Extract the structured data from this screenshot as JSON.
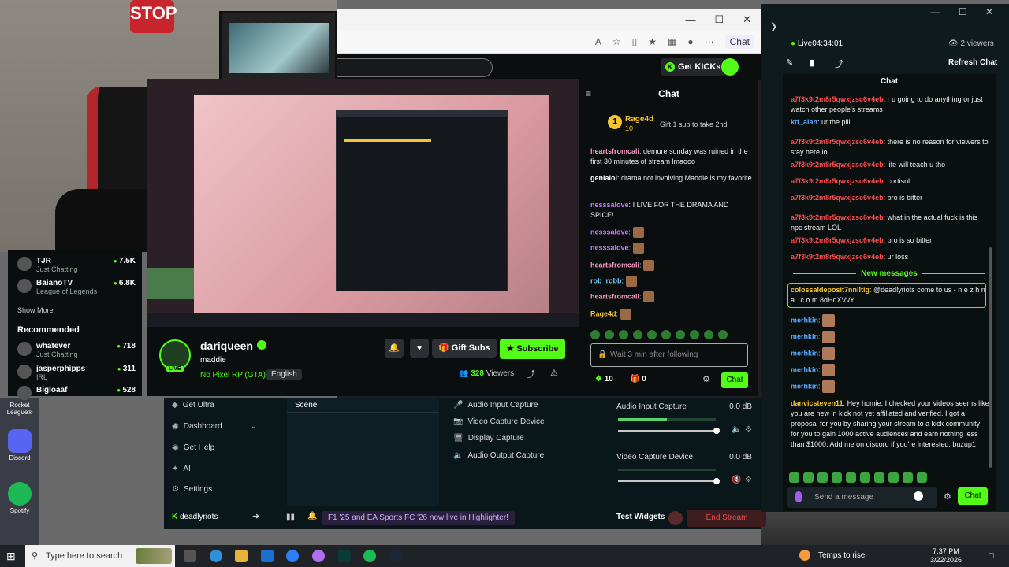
{
  "browser": {
    "chat_label": "Chat",
    "get_kicks": "Get KICKs"
  },
  "webcam": {
    "stop_sign": "STOP"
  },
  "sidebar": {
    "channels": [
      {
        "name": "TJR",
        "category": "Just Chatting",
        "viewers": "7.5K"
      },
      {
        "name": "BaianoTV",
        "category": "League of Legends",
        "viewers": "6.8K"
      }
    ],
    "show_more": "Show More",
    "recommended_title": "Recommended",
    "recommended": [
      {
        "name": "whatever",
        "category": "Just Chatting",
        "viewers": "718"
      },
      {
        "name": "jasperphipps",
        "category": "IRL",
        "viewers": "311"
      },
      {
        "name": "Bigloaaf",
        "category": "",
        "viewers": "528"
      }
    ]
  },
  "stream": {
    "streamer": "dariqueen",
    "live_tag": "LIVE",
    "title": "maddie",
    "category": "No Pixel RP (GTA)",
    "language": "English",
    "gift_subs": "Gift Subs",
    "subscribe": "Subscribe",
    "viewers_count": "328",
    "viewers_label": "Viewers"
  },
  "kick_chat": {
    "title": "Chat",
    "pinned": {
      "rank": "1",
      "user": "Rage4d",
      "amount": "10",
      "gift_text": "Gift 1 sub to take 2nd"
    },
    "messages": [
      {
        "user": "heartsfromcali",
        "text": "demure sunday was ruined in the first 30 minutes of stream lmaooo",
        "color": "#f49ac2"
      },
      {
        "user": "genialol",
        "text": "drama not involving Maddie is my favorite",
        "color": "#ffffff"
      },
      {
        "user": "nesssalove",
        "text": "I LIVE FOR THE DRAMA AND SPICE!",
        "color": "#c57cf5"
      },
      {
        "user": "nesssalove",
        "text": "",
        "color": "#c57cf5"
      },
      {
        "user": "nesssalove",
        "text": "",
        "color": "#c57cf5"
      },
      {
        "user": "heartsfromcali",
        "text": "",
        "color": "#f49ac2"
      },
      {
        "user": "rob_robb",
        "text": "",
        "color": "#7cc7f5"
      },
      {
        "user": "heartsfromcali",
        "text": "",
        "color": "#f49ac2"
      },
      {
        "user": "Rage4d",
        "text": "",
        "color": "#f4c430"
      }
    ],
    "input_placeholder": "Wait 3 min after following",
    "kicks_count": "10",
    "gift_count": "0",
    "chat_button": "Chat"
  },
  "streamlabs": {
    "nav": [
      "Get Ultra",
      "Dashboard",
      "Get Help",
      "AI",
      "Settings"
    ],
    "scene_header": "Scene",
    "sources": [
      "Audio Input Capture",
      "Video Capture Device",
      "Display Capture",
      "Audio Output Capture"
    ],
    "mixer": [
      {
        "label": "Audio Input Capture",
        "db": "0.0 dB",
        "level": 0.5
      },
      {
        "label": "Video Capture Device",
        "db": "0.0 dB",
        "level": 0
      }
    ],
    "user": "deadlyriots",
    "notification": "F1 '25 and EA Sports FC '26 now live in Highlighter!",
    "test_widgets": "Test Widgets",
    "end_stream": "End Stream"
  },
  "desktop_icons": [
    {
      "label": "Rocket League®",
      "color": "#2a5bd7"
    },
    {
      "label": "Discord",
      "color": "#5865f2"
    },
    {
      "label": "Spotify",
      "color": "#1db954"
    }
  ],
  "right_chat": {
    "live_label": "Live",
    "live_time": "04:34:01",
    "viewers": "2 viewers",
    "refresh": "Refresh Chat",
    "title": "Chat",
    "messages": [
      {
        "user": "a7f3k9t2m8r5qwxjzsc6v4eb",
        "text": "r u going to do anything or just watch other people's streams",
        "color": "#ff4d4d"
      },
      {
        "user": "ktf_alan",
        "text": "ur the pill",
        "color": "#5aa9ff"
      },
      {
        "user": "a7f3k9t2m8r5qwxjzsc6v4eb",
        "text": "there is no reason for viewers to stay here lol",
        "color": "#ff4d4d"
      },
      {
        "user": "a7f3k9t2m8r5qwxjzsc6v4eb",
        "text": "life will teach u tho",
        "color": "#ff4d4d"
      },
      {
        "user": "a7f3k9t2m8r5qwxjzsc6v4eb",
        "text": "cortisol",
        "color": "#ff4d4d"
      },
      {
        "user": "a7f3k9t2m8r5qwxjzsc6v4eb",
        "text": "bro is bitter",
        "color": "#ff4d4d"
      },
      {
        "user": "a7f3k9t2m8r5qwxjzsc6v4eb",
        "text": "what in the actual fuck is this npc stream LOL",
        "color": "#ff4d4d"
      },
      {
        "user": "a7f3k9t2m8r5qwxjzsc6v4eb",
        "text": "bro is so bitter",
        "color": "#ff4d4d"
      },
      {
        "user": "a7f3k9t2m8r5qwxjzsc6v4eb",
        "text": "ur loss",
        "color": "#ff4d4d"
      }
    ],
    "new_messages": "New messages",
    "highlighted": {
      "user": "colossaldeposit7nnlltig",
      "text": "@deadlyriots come to us - n e z h n a . c o m 8dHqXVvY",
      "color": "#f4c430"
    },
    "merhkin": [
      "merhkin",
      "merhkin",
      "merhkin",
      "merhkin",
      "merhkin"
    ],
    "long_msg": {
      "user": "danvicsteven11",
      "text": "Hey homie, I checked your videos seems like you are new in kick not yet affiliated and verified. I got a proposal for you by sharing your stream to a kick community for you to gain 1000 active audiences and earn nothing less than $1000. Add me on discord if you're interested: buzup1"
    },
    "input_placeholder": "Send a message",
    "chat_button": "Chat"
  },
  "taskbar": {
    "search_placeholder": "Type here to search",
    "weather": "Temps to rise",
    "time": "7:37 PM",
    "date": "3/22/2026"
  }
}
